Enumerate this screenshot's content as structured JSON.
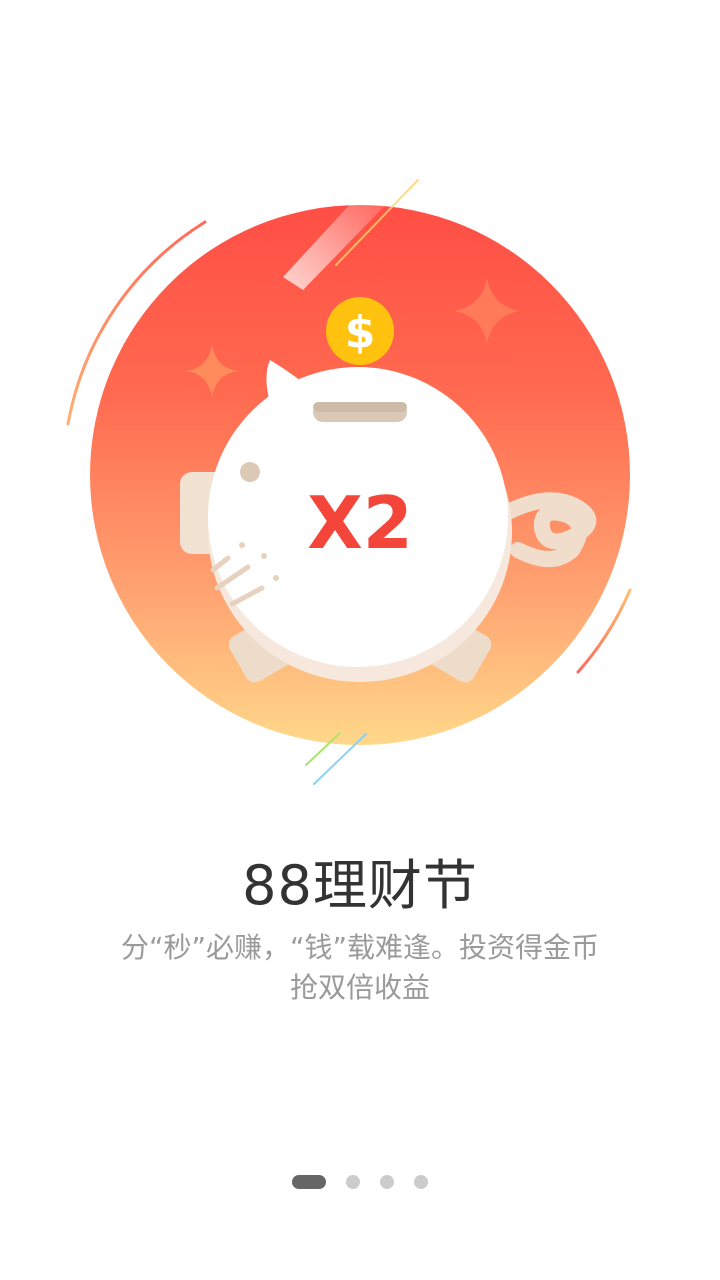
{
  "badge": {
    "text": "X2"
  },
  "coin": {
    "symbol": "$"
  },
  "title": "88理财节",
  "subtitle_line1": "分“秒”必赚，“钱”载难逢。投资得金币",
  "subtitle_line2": "抢双倍收益",
  "pager": {
    "current_page": 1,
    "total_pages": 4
  },
  "colors": {
    "circle_top": "#FF4F45",
    "circle_bottom": "#FFD68A",
    "accent_red": "#F4453B",
    "coin": "#FFC20E",
    "pig_ear": "#EEDCCB",
    "indicator_active": "#666666",
    "indicator_inactive": "#CCCCCC"
  }
}
